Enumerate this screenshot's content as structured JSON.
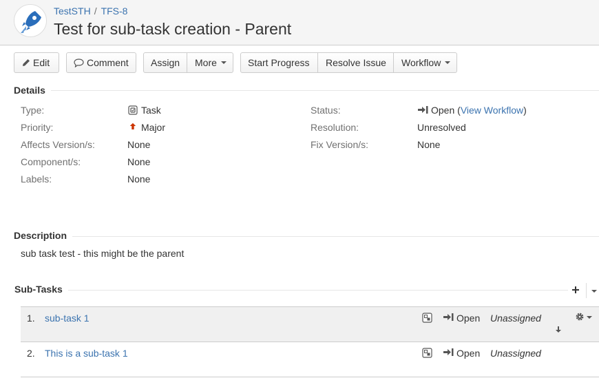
{
  "header": {
    "project": "TestSTH",
    "separator": "/",
    "issue_key": "TFS-8",
    "title": "Test for sub-task creation - Parent"
  },
  "toolbar": {
    "edit": "Edit",
    "comment": "Comment",
    "assign": "Assign",
    "more": "More",
    "start_progress": "Start Progress",
    "resolve_issue": "Resolve Issue",
    "workflow": "Workflow"
  },
  "details": {
    "heading": "Details",
    "type_label": "Type:",
    "type_value": "Task",
    "priority_label": "Priority:",
    "priority_value": "Major",
    "affects_label": "Affects Version/s:",
    "affects_value": "None",
    "component_label": "Component/s:",
    "component_value": "None",
    "labels_label": "Labels:",
    "labels_value": "None",
    "status_label": "Status:",
    "status_value": "Open",
    "view_workflow_open": "(",
    "view_workflow": "View Workflow",
    "view_workflow_close": ")",
    "resolution_label": "Resolution:",
    "resolution_value": "Unresolved",
    "fix_label": "Fix Version/s:",
    "fix_value": "None"
  },
  "description": {
    "heading": "Description",
    "text": "sub task test - this might be the parent"
  },
  "subtasks": {
    "heading": "Sub-Tasks",
    "items": [
      {
        "num": "1.",
        "summary": "sub-task 1",
        "status": "Open",
        "assignee": "Unassigned"
      },
      {
        "num": "2.",
        "summary": "This is a sub-task 1",
        "status": "Open",
        "assignee": "Unassigned"
      }
    ]
  },
  "colors": {
    "link": "#3b73af",
    "priority_major": "#cc3300",
    "header_bg": "#f5f5f5"
  },
  "icons": {
    "avatar": "rocket-icon",
    "edit": "pencil-icon",
    "comment": "speech-bubble-icon",
    "type": "task-icon",
    "priority": "arrow-up-icon",
    "status": "status-open-icon",
    "subtask": "subtask-icon",
    "add": "plus-icon",
    "options": "gear-icon",
    "move_down": "arrow-down-icon"
  }
}
